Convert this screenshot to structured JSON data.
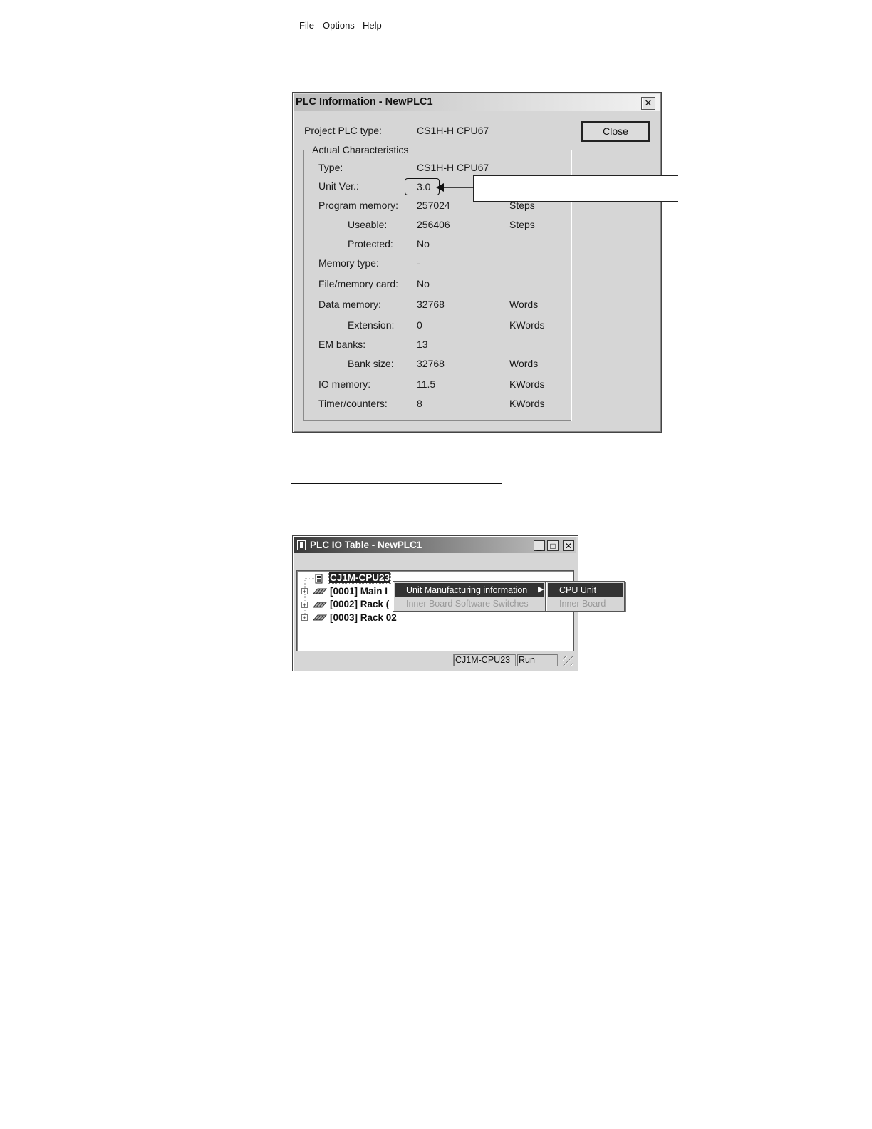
{
  "plc_info": {
    "title": "PLC Information - NewPLC1",
    "close_label": "Close",
    "project_type_label": "Project PLC type:",
    "project_type_value": "CS1H-H CPU67",
    "group_label": "Actual Characteristics",
    "rows": [
      {
        "label": "Type:",
        "value": "CS1H-H CPU67",
        "unit": ""
      },
      {
        "label": "Unit Ver.:",
        "value": "3.0",
        "unit": ""
      },
      {
        "label": "Program memory:",
        "value": "257024",
        "unit": "Steps"
      },
      {
        "label": "Useable:",
        "value": "256406",
        "unit": "Steps"
      },
      {
        "label": "Protected:",
        "value": "No",
        "unit": ""
      },
      {
        "label": "Memory type:",
        "value": "-",
        "unit": ""
      },
      {
        "label": "File/memory card:",
        "value": "No",
        "unit": ""
      },
      {
        "label": "Data memory:",
        "value": "32768",
        "unit": "Words"
      },
      {
        "label": "Extension:",
        "value": "0",
        "unit": "KWords"
      },
      {
        "label": "EM banks:",
        "value": "13",
        "unit": ""
      },
      {
        "label": "Bank size:",
        "value": "32768",
        "unit": "Words"
      },
      {
        "label": "IO memory:",
        "value": "11.5",
        "unit": "KWords"
      },
      {
        "label": "Timer/counters:",
        "value": "8",
        "unit": "KWords"
      }
    ]
  },
  "io_table": {
    "title": "PLC IO Table - NewPLC1",
    "menu": [
      "File",
      "Options",
      "Help"
    ],
    "tree": [
      "CJ1M-CPU23",
      "[0001] Main I",
      "[0002] Rack (",
      "[0003] Rack 02"
    ],
    "context_menu": [
      "Unit Manufacturing information",
      "Inner Board Software Switches"
    ],
    "submenu": [
      "CPU Unit",
      "Inner Board"
    ],
    "status": [
      "CJ1M-CPU23",
      "Run"
    ]
  }
}
